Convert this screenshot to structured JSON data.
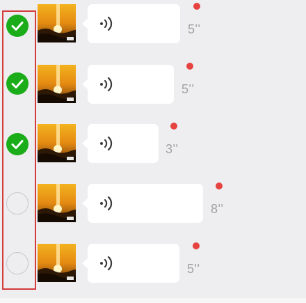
{
  "colors": {
    "background": "#eeedf0",
    "check_green": "#1aad19",
    "unread_red": "#e64340",
    "highlight_red": "#d43b3b",
    "bubble": "#ffffff",
    "duration_text": "#a3a3a6"
  },
  "icons": {
    "checkmark": "checkmark-icon",
    "voice": "voice-wave-icon",
    "avatar": "sunset-avatar"
  },
  "messages": [
    {
      "selected": true,
      "duration": "5''",
      "unread": true
    },
    {
      "selected": true,
      "duration": "5''",
      "unread": true
    },
    {
      "selected": true,
      "duration": "3''",
      "unread": true
    },
    {
      "selected": false,
      "duration": "8''",
      "unread": true
    },
    {
      "selected": false,
      "duration": "5''",
      "unread": true
    }
  ]
}
